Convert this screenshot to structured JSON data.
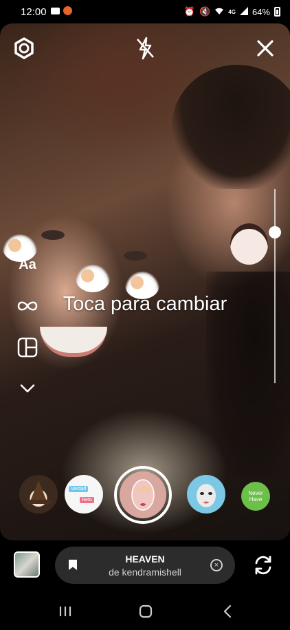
{
  "status_bar": {
    "time": "12:00",
    "network": "4G",
    "battery": "64%"
  },
  "camera": {
    "prompt_text": "Toca para cambiar",
    "text_tool_label": "Aa",
    "icons": [
      "settings-icon",
      "flash-off-icon",
      "close-icon",
      "infinity-icon",
      "layout-icon",
      "chevron-down-icon"
    ]
  },
  "effects": {
    "items": [
      {
        "name": "witch-hat-effect"
      },
      {
        "name": "verdad-reto-effect",
        "tag1": "Verdad",
        "tag2": "Reto"
      },
      {
        "name": "angel-selected-effect"
      },
      {
        "name": "face-mask-effect"
      },
      {
        "name": "never-have-effect",
        "label": "Never Have"
      }
    ]
  },
  "music": {
    "title": "HEAVEN",
    "artist": "de kendramishell"
  },
  "colors": {
    "background": "#000000",
    "music_pill": "#2c2c2c",
    "accent_white": "#ffffff"
  }
}
